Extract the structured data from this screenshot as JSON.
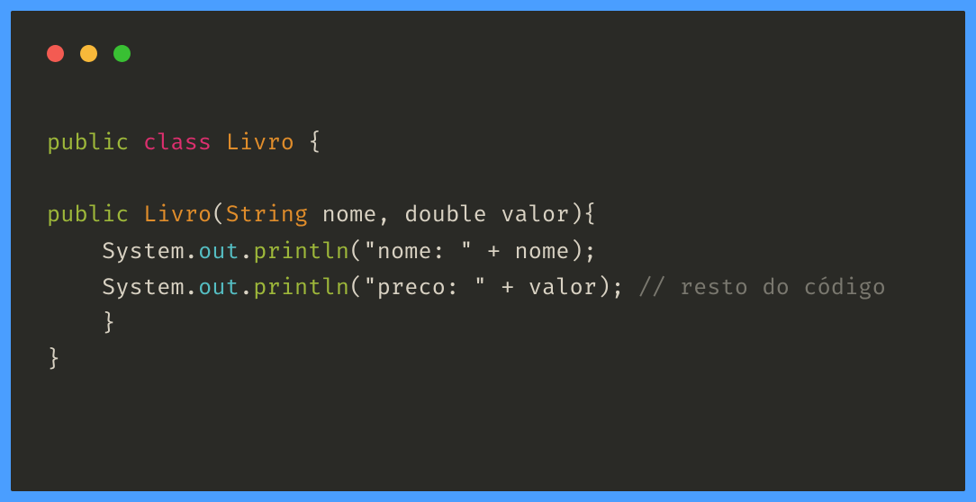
{
  "window": {
    "lights": [
      "red",
      "yellow",
      "green"
    ]
  },
  "code": {
    "line1": {
      "kw_public": "public",
      "kw_class": "class",
      "classname": "Livro",
      "brace": "{"
    },
    "line2": "",
    "line3": {
      "kw_public": "public",
      "ctor": "Livro",
      "lparen": "(",
      "type1": "String",
      "param1": "nome",
      "comma": ",",
      "type2": "double",
      "param2": "valor",
      "rparen": ")",
      "brace": "{"
    },
    "line4": {
      "indent": "    ",
      "obj": "System",
      "dot1": ".",
      "field": "out",
      "dot2": ".",
      "method": "println",
      "lparen": "(",
      "string": "\"nome: \"",
      "plus": " + ",
      "var": "nome",
      "rparen": ")",
      "semi": ";"
    },
    "line5": {
      "indent": "    ",
      "obj": "System",
      "dot1": ".",
      "field": "out",
      "dot2": ".",
      "method": "println",
      "lparen": "(",
      "string": "\"preco: \"",
      "plus": " + ",
      "var": "valor",
      "rparen": ")",
      "semi": ";",
      "comment": " // resto do código"
    },
    "line6": {
      "indent": "    ",
      "brace": "}"
    },
    "line7": {
      "brace": "}"
    }
  }
}
